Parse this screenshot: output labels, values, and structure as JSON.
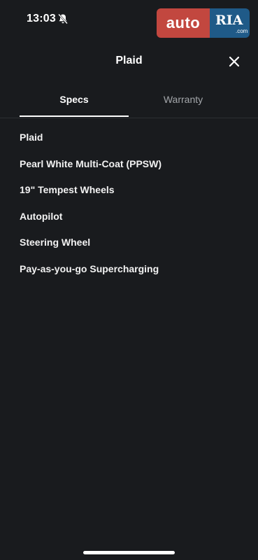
{
  "status_bar": {
    "time": "13:03",
    "icons": [
      "bell-slash-icon",
      "wifi-icon"
    ]
  },
  "watermark": {
    "left_text": "auto",
    "right_text": "RIA",
    "right_suffix": ".com",
    "colors": {
      "left": "#c2473f",
      "right": "#1f5a88"
    }
  },
  "header": {
    "title": "Plaid",
    "close_icon": "close-icon"
  },
  "tabs": [
    {
      "label": "Specs",
      "active": true
    },
    {
      "label": "Warranty",
      "active": false
    }
  ],
  "specs": [
    "Plaid",
    "Pearl White Multi-Coat (PPSW)",
    "19\" Tempest Wheels",
    "Autopilot",
    "Steering Wheel",
    "Pay-as-you-go Supercharging"
  ],
  "colors": {
    "background": "#191b1e",
    "text": "#ffffff",
    "inactive_tab": "#a3a6aa",
    "divider": "#2c2f33"
  }
}
